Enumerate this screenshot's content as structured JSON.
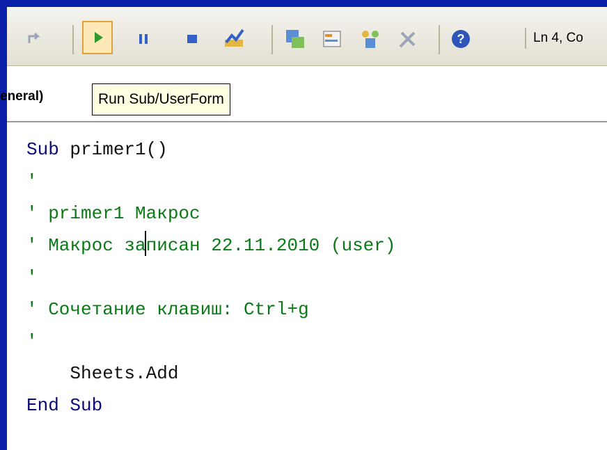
{
  "toolbar": {
    "run_tooltip": "Run Sub/UserForm",
    "status": "Ln 4, Co"
  },
  "procedure_bar": {
    "object_label": "eneral)"
  },
  "code_lines": [
    {
      "parts": [
        {
          "t": "Sub",
          "c": "kw"
        },
        {
          "t": " primer1()",
          "c": "txt"
        }
      ]
    },
    {
      "parts": [
        {
          "t": "'",
          "c": "cm"
        }
      ]
    },
    {
      "parts": [
        {
          "t": "' primer1 Макрос",
          "c": "cm"
        }
      ]
    },
    {
      "parts": [
        {
          "t": "' Макрос записан 22.11.2010 (user)",
          "c": "cm"
        }
      ]
    },
    {
      "parts": [
        {
          "t": "'",
          "c": "cm"
        }
      ]
    },
    {
      "parts": [
        {
          "t": "' Сочетание клавиш: Ctrl+g",
          "c": "cm"
        }
      ]
    },
    {
      "parts": [
        {
          "t": "'",
          "c": "cm"
        }
      ]
    },
    {
      "parts": [
        {
          "t": "    Sheets.Add",
          "c": "txt"
        }
      ]
    },
    {
      "parts": [
        {
          "t": "End Sub",
          "c": "kw"
        }
      ]
    }
  ]
}
